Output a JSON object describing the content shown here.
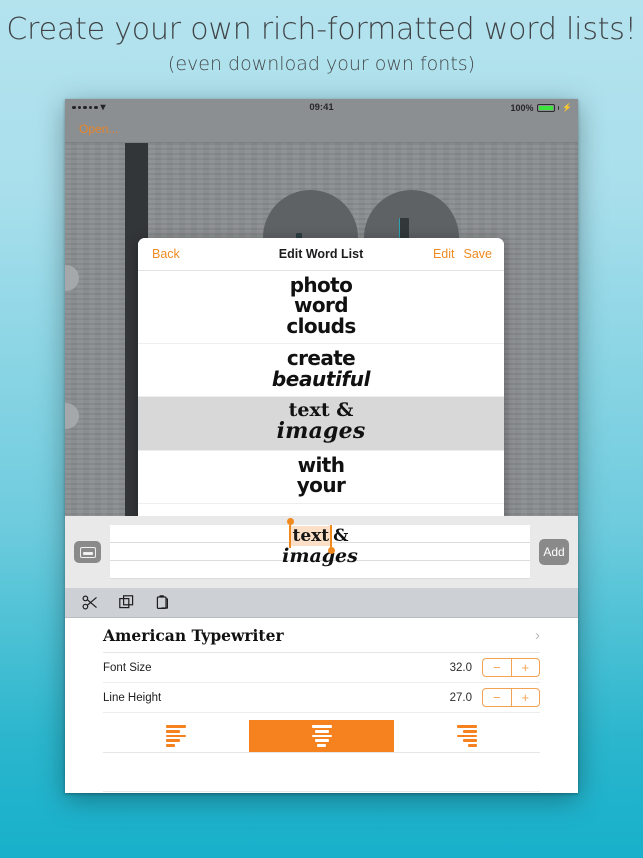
{
  "promo": {
    "headline": "Create your own rich-formatted word lists!",
    "subhead": "(even download your own fonts)"
  },
  "status_bar": {
    "signal_dots": 5,
    "wifi_icon": "wifi-icon",
    "time": "09:41",
    "battery_percent": "100%",
    "battery_charging": true
  },
  "app_toolbar": {
    "open_label": "Open..."
  },
  "modal": {
    "back_label": "Back",
    "title": "Edit Word List",
    "edit_label": "Edit",
    "save_label": "Save",
    "rows": [
      {
        "lines": [
          "photo",
          "word",
          "clouds"
        ],
        "styles": [
          "cond",
          "cond",
          "cond"
        ],
        "selected": false
      },
      {
        "lines": [
          "create",
          "beautiful"
        ],
        "styles": [
          "cond",
          "ital"
        ],
        "selected": false
      },
      {
        "lines": [
          "text &",
          "images"
        ],
        "styles": [
          "slab",
          "script"
        ],
        "selected": true
      },
      {
        "lines": [
          "with",
          "your"
        ],
        "styles": [
          "cond",
          "cond"
        ],
        "selected": false
      },
      {
        "lines": [],
        "styles": [],
        "selected": false
      },
      {
        "lines": [],
        "styles": [],
        "selected": false
      }
    ]
  },
  "input_strip": {
    "keyboard_button": "keyboard-icon",
    "selected_text": "text",
    "trailing_text": "&",
    "second_line": "images",
    "add_label": "Add"
  },
  "clipboard_toolbar": {
    "items": [
      "cut-icon",
      "copy-icon",
      "paste-icon"
    ]
  },
  "settings": {
    "font_name": "American Typewriter",
    "chevron": "›",
    "options": [
      {
        "label": "Font Size",
        "value": "32.0",
        "minus": "−",
        "plus": "+"
      },
      {
        "label": "Line Height",
        "value": "27.0",
        "minus": "−",
        "plus": "+"
      }
    ],
    "alignment": {
      "options": [
        "align-left",
        "align-center",
        "align-right"
      ],
      "selected": "align-center"
    }
  },
  "colors": {
    "accent_orange": "#f5811f",
    "link_orange": "#ef8b22",
    "bg_top": "#b4e3ee",
    "bg_bottom": "#17b0cb",
    "canvas_gray": "#8a8d8f",
    "selected_row": "#d8d8d8"
  }
}
